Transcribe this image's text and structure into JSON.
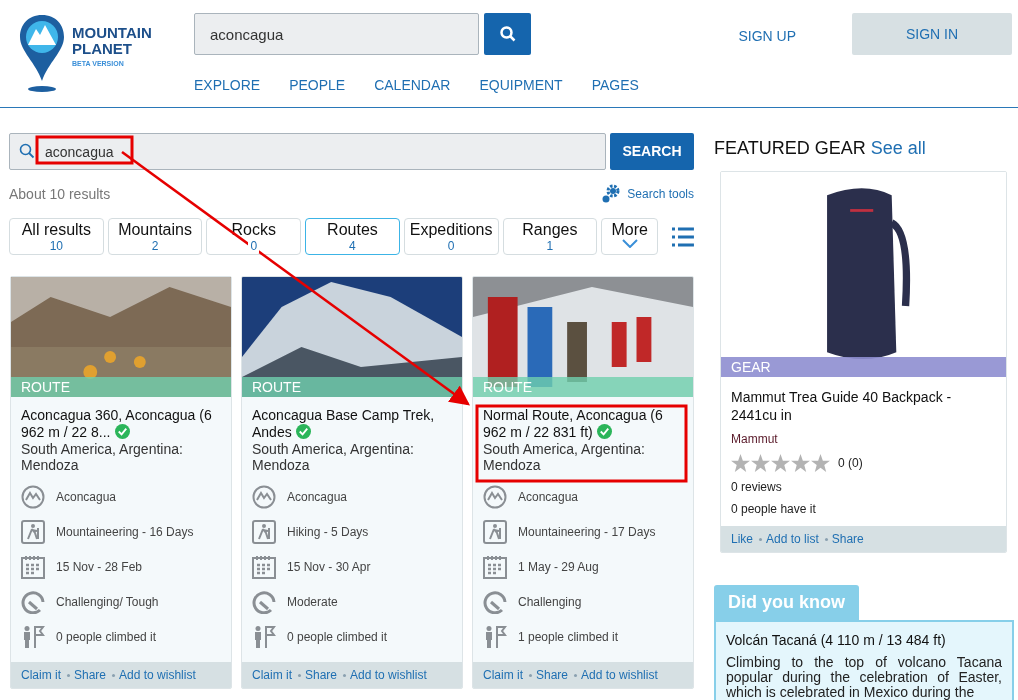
{
  "header": {
    "logo": {
      "line1": "MOUNTAIN",
      "line2": "PLANET",
      "tagline": "BETA VERSION"
    },
    "search": {
      "value": "aconcagua"
    },
    "sign_up": "SIGN UP",
    "sign_in": "SIGN IN",
    "nav": [
      "EXPLORE",
      "PEOPLE",
      "CALENDAR",
      "EQUIPMENT",
      "PAGES"
    ]
  },
  "search": {
    "value": "aconcagua",
    "button": "SEARCH",
    "results_count": "About 10 results",
    "tools": "Search tools"
  },
  "tabs": [
    {
      "kind": "count",
      "label": "All results",
      "count": "10",
      "selected": false
    },
    {
      "kind": "count",
      "label": "Mountains",
      "count": "2",
      "selected": false
    },
    {
      "kind": "count",
      "label": "Rocks",
      "count": "0",
      "selected": false
    },
    {
      "kind": "count",
      "label": "Routes",
      "count": "4",
      "selected": true
    },
    {
      "kind": "count",
      "label": "Expeditions",
      "count": "0",
      "selected": false
    },
    {
      "kind": "count",
      "label": "Ranges",
      "count": "1",
      "selected": false
    },
    {
      "kind": "more",
      "label": "More",
      "selected": false
    }
  ],
  "results": [
    {
      "badge": "ROUTE",
      "title": "Aconcagua 360, Aconcagua (6 962 m / 22 8...",
      "verified": true,
      "location": "South America, Argentina: Mendoza",
      "facts": [
        {
          "kind": "mountain",
          "text": "Aconcagua"
        },
        {
          "kind": "activity",
          "text": "Mountaineering - 16 Days"
        },
        {
          "kind": "calendar",
          "text": "15 Nov - 28 Feb"
        },
        {
          "kind": "difficulty",
          "text": "Challenging/ Tough"
        },
        {
          "kind": "climbers",
          "text": "0 people climbed it"
        }
      ],
      "actions": [
        "Claim it",
        "Share",
        "Add to wishlist"
      ]
    },
    {
      "badge": "ROUTE",
      "title": "Aconcagua Base Camp Trek, Andes",
      "verified": true,
      "location": "South America, Argentina: Mendoza",
      "facts": [
        {
          "kind": "mountain",
          "text": "Aconcagua"
        },
        {
          "kind": "activity",
          "text": "Hiking - 5 Days"
        },
        {
          "kind": "calendar",
          "text": "15 Nov - 30 Apr"
        },
        {
          "kind": "difficulty",
          "text": "Moderate"
        },
        {
          "kind": "climbers",
          "text": "0 people climbed it"
        }
      ],
      "actions": [
        "Claim it",
        "Share",
        "Add to wishlist"
      ]
    },
    {
      "badge": "ROUTE",
      "title": "Normal Route, Aconcagua (6 962 m / 22 831 ft)",
      "verified": true,
      "location": "South America, Argentina: Mendoza",
      "facts": [
        {
          "kind": "mountain",
          "text": "Aconcagua"
        },
        {
          "kind": "activity",
          "text": "Mountaineering - 17 Days"
        },
        {
          "kind": "calendar",
          "text": "1 May - 29 Aug"
        },
        {
          "kind": "difficulty",
          "text": "Challenging"
        },
        {
          "kind": "climbers",
          "text": "1 people climbed it"
        }
      ],
      "actions": [
        "Claim it",
        "Share",
        "Add to wishlist"
      ]
    }
  ],
  "featured_gear": {
    "title": "FEATURED GEAR",
    "see_all": "See all",
    "badge": "GEAR",
    "name": "Mammut Trea Guide 40 Backpack - 2441cu in",
    "brand": "Mammut",
    "stars": 0,
    "rating": "0 (0)",
    "reviews": "0 reviews",
    "owners": "0 people have it",
    "actions": [
      "Like",
      "Add to list",
      "Share"
    ]
  },
  "did_you_know": {
    "title": "Did you know",
    "heading": "Volcán Tacaná (4 110 m / 13 484 ft)",
    "text": "Climbing to the top of volcano Tacana popular during the celebration of Easter, which is celebrated in Mexico during the"
  }
}
